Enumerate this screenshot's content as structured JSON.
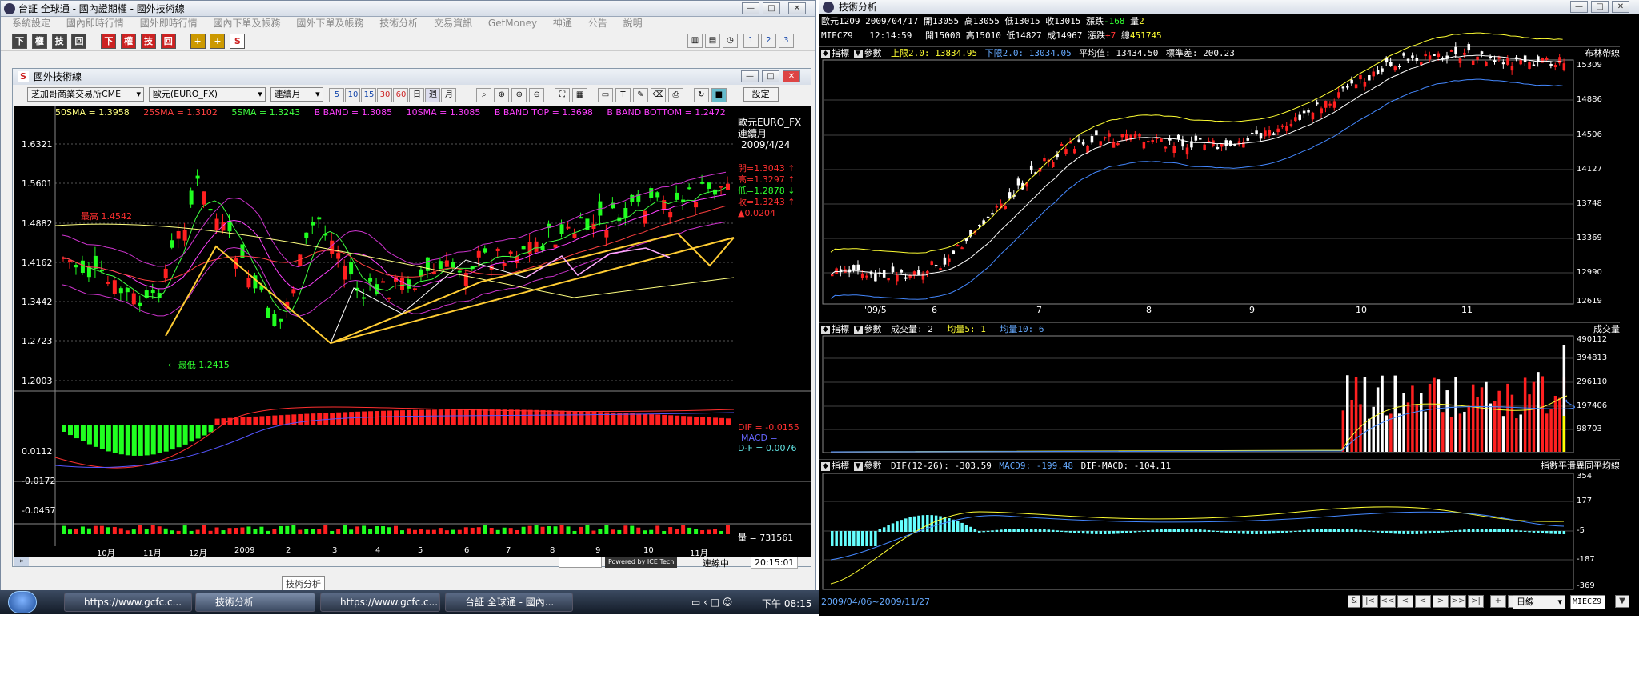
{
  "left_window": {
    "title": "台証 全球通 - 國內證期權 - 國外技術線",
    "menu": [
      "系統設定",
      "國內即時行情",
      "國外即時行情",
      "國內下單及帳務",
      "國外下單及帳務",
      "技術分析",
      "交易資訊",
      "GetMoney",
      "神通",
      "公告",
      "說明"
    ],
    "toolbar_buttons": [
      "下",
      "權",
      "技",
      "回",
      "下",
      "權",
      "技",
      "回",
      "+",
      "+",
      "S"
    ],
    "child_title": "國外技術線",
    "exchange_select": "芝加哥商業交易所CME",
    "product_select": "歐元(EURO_FX)",
    "period_select": "連續月",
    "interval_buttons": [
      "5",
      "10",
      "15",
      "30",
      "60",
      "日",
      "週",
      "月"
    ],
    "settings_button": "設定",
    "legend": [
      {
        "text": "50SMA = 1.3958",
        "color": "#ffff80"
      },
      {
        "text": "25SMA = 1.3102",
        "color": "#ff4040"
      },
      {
        "text": "5SMA = 1.3243",
        "color": "#40ff40"
      },
      {
        "text": "B BAND = 1.3085",
        "color": "#ff40ff"
      },
      {
        "text": "10SMA = 1.3085",
        "color": "#ff40ff"
      },
      {
        "text": "B BAND TOP = 1.3698",
        "color": "#ff40ff"
      },
      {
        "text": "B BAND BOTTOM = 1.2472",
        "color": "#ff40ff"
      }
    ],
    "y_ticks": [
      "1.6321",
      "1.5601",
      "1.4882",
      "1.4162",
      "1.3442",
      "1.2723",
      "1.2003"
    ],
    "macd_ticks": [
      "0.0112",
      "-0.0172",
      "-0.0457"
    ],
    "x_ticks": [
      "10月",
      "11月",
      "12月",
      "2009",
      "2",
      "3",
      "4",
      "5",
      "6",
      "7",
      "8",
      "9",
      "10",
      "11月"
    ],
    "info": {
      "name": "歐元EURO_FX",
      "period": "連續月",
      "date": "2009/4/24",
      "open": "開=1.3043 ↑",
      "high": "高=1.3297 ↑",
      "low": "低=1.2878 ↓",
      "close": "收=1.3243 ↑",
      "change": "▲0.0204"
    },
    "annotation_high": "最高 1.4542",
    "annotation_low": "← 最低 1.2415",
    "macd_labels": {
      "dif": "DIF = -0.0155",
      "macd": "MACD =",
      "df": "D-F = 0.0076"
    },
    "volume_label": "量 = 731561",
    "status": {
      "ice": "Powered by ICE Tech",
      "conn": "連線中",
      "time": "20:15:01"
    },
    "tooltip": "技術分析"
  },
  "right_window": {
    "title": "技術分析",
    "quote_line1": {
      "code": "歐元1209",
      "date": "2009/04/17",
      "open_l": "開",
      "open": "13055",
      "high_l": "高",
      "high": "13055",
      "low_l": "低",
      "low": "13015",
      "close_l": "收",
      "close": "13015",
      "chg_l": "漲跌",
      "chg": "-168",
      "vol_l": "量",
      "vol": "2"
    },
    "quote_line2": {
      "code": "MIECZ9",
      "time": "12:14:59",
      "open_l": "開",
      "open": "15000",
      "high_l": "高",
      "high": "15010",
      "low_l": "低",
      "low": "14827",
      "close_l": "成",
      "close": "14967",
      "chg_l": "漲跌",
      "chg": "+7",
      "vol_l": "總",
      "vol": "451745"
    },
    "pane1": {
      "btn1": "指標",
      "btn2": "參數",
      "params": "上限2.0: 13834.95",
      "params2": "下限2.0: 13034.05",
      "params3": "平均值: 13434.50",
      "params4": "標準差: 200.23",
      "name": "布林帶線",
      "y_ticks": [
        "15309",
        "14886",
        "14506",
        "14127",
        "13748",
        "13369",
        "12990",
        "12619"
      ],
      "x_ticks": [
        "'09/5",
        "6",
        "7",
        "8",
        "9",
        "10",
        "11"
      ]
    },
    "pane2": {
      "btn1": "指標",
      "btn2": "參數",
      "params": "成交量: 2",
      "params2": "均量5: 1",
      "params3": "均量10: 6",
      "name": "成交量",
      "y_ticks": [
        "490112",
        "394813",
        "296110",
        "197406",
        "98703"
      ]
    },
    "pane3": {
      "btn1": "指標",
      "btn2": "參數",
      "params": "DIF(12-26): -303.59",
      "params2": "MACD9: -199.48",
      "params3": "DIF-MACD: -104.11",
      "name": "指數平滑異同平均線",
      "y_ticks": [
        "354",
        "177",
        "-5",
        "-187",
        "-369"
      ]
    },
    "date_range": "2009/04/06~2009/11/27",
    "nav_buttons": [
      "&",
      "|<",
      "<<",
      "<",
      "<",
      ">",
      ">>",
      ">|",
      "+",
      "-"
    ],
    "period_select": "日線",
    "code_input": "MIECZ9"
  },
  "taskbar": {
    "items": [
      "https://www.gcfc.c...",
      "技術分析",
      "https://www.gcfc.c...",
      "台証 全球通 - 國內..."
    ],
    "clock": "下午 08:15"
  },
  "colors": {
    "up": "#ff2020",
    "down": "#20ff20",
    "bg": "#000000"
  }
}
